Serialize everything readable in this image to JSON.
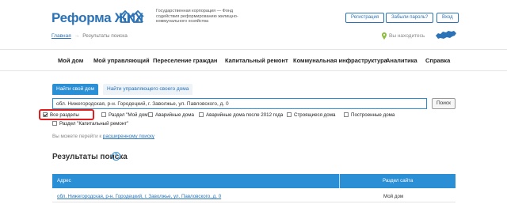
{
  "header": {
    "logo": "Реформа ЖКХ",
    "org_name": "Государственная корпорация — Фонд содействия реформированию жилищно-коммунального хозяйства",
    "register": "Регистрация",
    "forgot": "Забыли пароль?",
    "login": "Вход",
    "location": "Вы находитесь"
  },
  "breadcrumb": {
    "home": "Главная",
    "current": "Результаты поиска"
  },
  "nav": [
    "Мой дом",
    "Мой управляющий",
    "Переселение граждан",
    "Капитальный ремонт",
    "Коммунальная инфраструктура",
    "Аналитика",
    "Справка"
  ],
  "search": {
    "tab_active": "Найти свой дом",
    "tab_other": "Найти управляющего своего дома",
    "query": "обл. Нижегородская, р-н. Городецкий, г. Заволжье, ул. Павловского, д. 0",
    "button": "Поиск"
  },
  "filters": [
    {
      "label": "Все разделы",
      "checked": true
    },
    {
      "label": "Раздел \"Мой дом\"",
      "checked": false
    },
    {
      "label": "Аварийные дома",
      "checked": false
    },
    {
      "label": "Аварийные дома после 2012 года",
      "checked": false
    },
    {
      "label": "Строящиеся дома",
      "checked": false
    },
    {
      "label": "Построенные дома",
      "checked": false
    },
    {
      "label": "Раздел \"Капитальный ремонт\"",
      "checked": false
    }
  ],
  "advanced": {
    "text": "Вы можете перейти к",
    "link": "расширенному поиску"
  },
  "results": {
    "title": "Результаты поиска",
    "help": "?",
    "columns": [
      "Адрес",
      "Раздел сайта"
    ],
    "rows": [
      {
        "address": "обл. Нижегородская, р-н. Городецкий, г. Заволжье, ул. Павловского, д. 0",
        "section": "Мой дом"
      }
    ]
  },
  "colors": {
    "accent": "#2b8fd6",
    "brand": "#2b73b6",
    "highlight": "#e02020"
  }
}
